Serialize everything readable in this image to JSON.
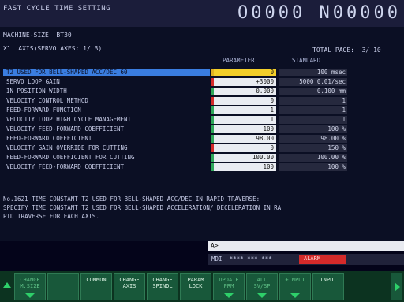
{
  "header": {
    "title": "FAST CYCLE TIME SETTING",
    "program": "O0000 N00000"
  },
  "info": {
    "machine_size": "MACHINE-SIZE  BT30",
    "axis_line": "X1  AXIS(SERVO AXES: 1/ 3)",
    "total_page": "TOTAL PAGE:  3/ 10"
  },
  "columns": {
    "param": "PARAMETER",
    "standard": "STANDARD"
  },
  "rows": [
    {
      "label": "T2 USED FOR BELL-SHAPED ACC/DEC 60",
      "param": "0",
      "standard": "100 msec",
      "mark": "#e0b020"
    },
    {
      "label": "SERVO LOOP GAIN",
      "param": "+3000",
      "standard": "5000 0.01/sec",
      "mark": "#d42a2a"
    },
    {
      "label": "IN POSITION WIDTH",
      "param": "0.000",
      "standard": "0.100 mm",
      "mark": "#2ea85a"
    },
    {
      "label": "VELOCITY CONTROL METHOD",
      "param": "0",
      "standard": "1",
      "mark": "#d42a2a"
    },
    {
      "label": "FEED-FORWARD FUNCTION",
      "param": "1",
      "standard": "1",
      "mark": "#2ea85a"
    },
    {
      "label": "VELOCITY LOOP HIGH CYCLE MANAGEMENT",
      "param": "1",
      "standard": "1",
      "mark": "#2ea85a"
    },
    {
      "label": "VELOCITY FEED-FORWARD COEFFICIENT",
      "param": "100",
      "standard": "100 %",
      "mark": "#2ea85a"
    },
    {
      "label": "FEED-FORWARD COEFFICIENT",
      "param": "98.00",
      "standard": "98.00 %",
      "mark": "#2ea85a"
    },
    {
      "label": "VELOCITY GAIN OVERRIDE FOR CUTTING",
      "param": "0",
      "standard": "150 %",
      "mark": "#d42a2a"
    },
    {
      "label": "FEED-FORWARD COEFFICIENT FOR CUTTING",
      "param": "100.00",
      "standard": "100.00 %",
      "mark": "#2ea85a"
    },
    {
      "label": "VELOCITY FEED-FORWARD COEFFICIENT",
      "param": "100",
      "standard": "100 %",
      "mark": "#2ea85a"
    }
  ],
  "description": "No.1621 TIME CONSTANT T2 USED FOR BELL-SHAPED ACC/DEC IN RAPID TRAVERSE:\nSPECIFY TIME CONSTANT T2 USED FOR BELL-SHAPED ACCELERATION/ DECELERATION IN RA\nPID TRAVERSE FOR EACH AXIS.",
  "input_prompt": "A>",
  "status": {
    "mode": "MDI  **** *** ***",
    "alarm": "ALARM"
  },
  "softkeys": [
    {
      "label": "CHANGE\nM.SIZE",
      "dim": true,
      "tri": true
    },
    {
      "label": "",
      "dim": false,
      "tri": false
    },
    {
      "label": "COMMON",
      "dim": false,
      "tri": false
    },
    {
      "label": "CHANGE\nAXIS",
      "dim": false,
      "tri": false
    },
    {
      "label": "CHANGE\nSPINDL",
      "dim": false,
      "tri": false
    },
    {
      "label": "PARAM\nLOCK",
      "dim": false,
      "tri": false
    },
    {
      "label": "UPDATE\nPRM",
      "dim": true,
      "tri": true
    },
    {
      "label": "ALL\nSV/SP",
      "dim": true,
      "tri": true
    },
    {
      "label": "+INPUT",
      "dim": true,
      "tri": true
    },
    {
      "label": "INPUT",
      "dim": false,
      "tri": false
    }
  ]
}
